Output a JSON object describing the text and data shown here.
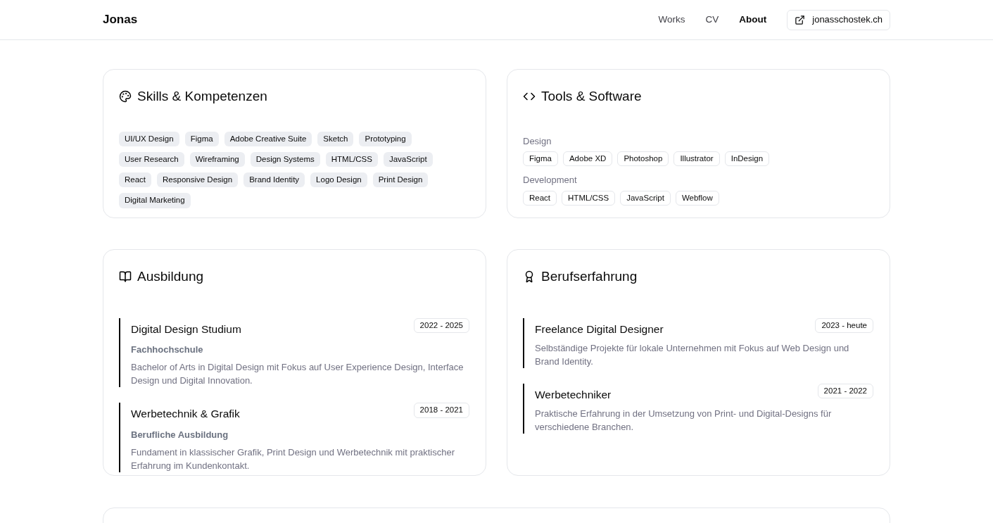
{
  "header": {
    "logo": "Jonas",
    "nav": [
      {
        "label": "Works",
        "selected": false
      },
      {
        "label": "CV",
        "selected": false
      },
      {
        "label": "About",
        "selected": true
      }
    ],
    "external_link": "jonasschostek.ch"
  },
  "skills": {
    "title": "Skills & Kompetenzen",
    "tags": [
      "UI/UX Design",
      "Figma",
      "Adobe Creative Suite",
      "Sketch",
      "Prototyping",
      "User Research",
      "Wireframing",
      "Design Systems",
      "HTML/CSS",
      "JavaScript",
      "React",
      "Responsive Design",
      "Brand Identity",
      "Logo Design",
      "Print Design",
      "Digital Marketing"
    ]
  },
  "tools": {
    "title": "Tools & Software",
    "groups": [
      {
        "label": "Design",
        "tags": [
          "Figma",
          "Adobe XD",
          "Photoshop",
          "Illustrator",
          "InDesign"
        ]
      },
      {
        "label": "Development",
        "tags": [
          "React",
          "HTML/CSS",
          "JavaScript",
          "Webflow"
        ]
      }
    ]
  },
  "education": {
    "title": "Ausbildung",
    "entries": [
      {
        "title": "Digital Design Studium",
        "period": "2022 - 2025",
        "institution": "Fachhochschule",
        "description": "Bachelor of Arts in Digital Design mit Fokus auf User Experience Design, Interface Design und Digital Innovation."
      },
      {
        "title": "Werbetechnik & Grafik",
        "period": "2018 - 2021",
        "institution": "Berufliche Ausbildung",
        "description": "Fundament in klassischer Grafik, Print Design und Werbetechnik mit praktischer Erfahrung im Kundenkontakt."
      }
    ]
  },
  "experience": {
    "title": "Berufserfahrung",
    "entries": [
      {
        "title": "Freelance Digital Designer",
        "period": "2023 - heute",
        "description": "Selbständige Projekte für lokale Unternehmen mit Fokus auf Web Design und Brand Identity."
      },
      {
        "title": "Werbetechniker",
        "period": "2021 - 2022",
        "description": "Praktische Erfahrung in der Umsetzung von Print- und Digital-Designs für verschiedene Branchen."
      }
    ]
  }
}
